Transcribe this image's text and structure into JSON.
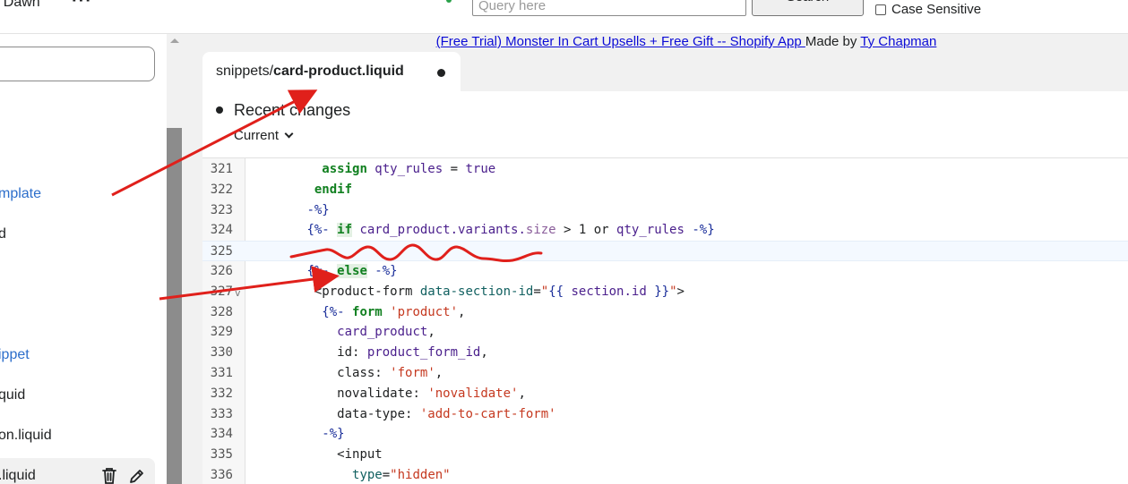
{
  "topbar": {
    "theme_name": "r Dawn",
    "more_icon": "more-horizontal-icon",
    "search_placeholder": "Query here",
    "search_button": "Search",
    "case_sensitive_label": "Case Sensitive"
  },
  "sidebar": {
    "items": [
      {
        "label": "mplate",
        "style": "link"
      },
      {
        "label": "d",
        "style": "text"
      },
      {
        "label": "ippet",
        "style": "link"
      },
      {
        "label": "quid",
        "style": "text"
      },
      {
        "label": "on.liquid",
        "style": "text"
      },
      {
        "label": ".liquid",
        "style": "text"
      }
    ],
    "selected_actions": [
      "trash-icon",
      "pencil-icon"
    ]
  },
  "banner": {
    "link_text": "(Free Trial) Monster In Cart Upsells + Free Gift -- Shopify App ",
    "made_by": "Made by ",
    "author": "Ty Chapman"
  },
  "editor": {
    "tab": {
      "dir": "snippets/",
      "file": "card-product.liquid"
    },
    "recent_changes": "Recent changes",
    "version_label": "Current"
  },
  "code": {
    "lines": [
      {
        "n": "321",
        "indent": "          ",
        "tokens": [
          [
            "kw",
            "assign"
          ],
          [
            "var",
            " qty_rules"
          ],
          [
            "plain",
            " = "
          ],
          [
            "var",
            "true"
          ]
        ]
      },
      {
        "n": "322",
        "indent": "         ",
        "tokens": [
          [
            "kw",
            "endif"
          ]
        ]
      },
      {
        "n": "323",
        "indent": "        ",
        "tokens": [
          [
            "delim",
            "-%}"
          ]
        ]
      },
      {
        "n": "324",
        "indent": "        ",
        "tokens": [
          [
            "delim",
            "{%- "
          ],
          [
            "kwhl",
            "if"
          ],
          [
            "var",
            " card_product.variants."
          ],
          [
            "prop",
            "size"
          ],
          [
            "plain",
            " > 1 or "
          ],
          [
            "var",
            "qty_rules"
          ],
          [
            "delim",
            " -%}"
          ]
        ]
      },
      {
        "n": "325",
        "indent": "",
        "tokens": []
      },
      {
        "n": "326",
        "indent": "        ",
        "tokens": [
          [
            "delim",
            "{%- "
          ],
          [
            "kwhl",
            "else"
          ],
          [
            "delim",
            " -%}"
          ]
        ]
      },
      {
        "n": "327",
        "indent": "         ",
        "fold": true,
        "tokens": [
          [
            "tag",
            "<product-form "
          ],
          [
            "attr",
            "data-section-id"
          ],
          [
            "plain",
            "="
          ],
          [
            "str",
            "\""
          ],
          [
            "delim",
            "{{ "
          ],
          [
            "var",
            "section.id"
          ],
          [
            "delim",
            " }}"
          ],
          [
            "str",
            "\""
          ],
          [
            "tag",
            ">"
          ]
        ]
      },
      {
        "n": "328",
        "indent": "          ",
        "tokens": [
          [
            "delim",
            "{%- "
          ],
          [
            "kw",
            "form"
          ],
          [
            "str",
            " 'product'"
          ],
          [
            "plain",
            ","
          ]
        ]
      },
      {
        "n": "329",
        "indent": "            ",
        "tokens": [
          [
            "var",
            "card_product"
          ],
          [
            "plain",
            ","
          ]
        ]
      },
      {
        "n": "330",
        "indent": "            ",
        "tokens": [
          [
            "plain",
            "id: "
          ],
          [
            "var",
            "product_form_id"
          ],
          [
            "plain",
            ","
          ]
        ]
      },
      {
        "n": "331",
        "indent": "            ",
        "tokens": [
          [
            "plain",
            "class: "
          ],
          [
            "str",
            "'form'"
          ],
          [
            "plain",
            ","
          ]
        ]
      },
      {
        "n": "332",
        "indent": "            ",
        "tokens": [
          [
            "plain",
            "novalidate: "
          ],
          [
            "str",
            "'novalidate'"
          ],
          [
            "plain",
            ","
          ]
        ]
      },
      {
        "n": "333",
        "indent": "            ",
        "tokens": [
          [
            "plain",
            "data-type: "
          ],
          [
            "str",
            "'add-to-cart-form'"
          ]
        ]
      },
      {
        "n": "334",
        "indent": "          ",
        "tokens": [
          [
            "delim",
            "-%}"
          ]
        ]
      },
      {
        "n": "335",
        "indent": "            ",
        "tokens": [
          [
            "tag",
            "<input"
          ]
        ]
      },
      {
        "n": "336",
        "indent": "              ",
        "tokens": [
          [
            "attr",
            "type"
          ],
          [
            "plain",
            "="
          ],
          [
            "str",
            "\"hidden\""
          ]
        ]
      }
    ],
    "active_line": "325"
  },
  "annotation_color": "#e0201b"
}
